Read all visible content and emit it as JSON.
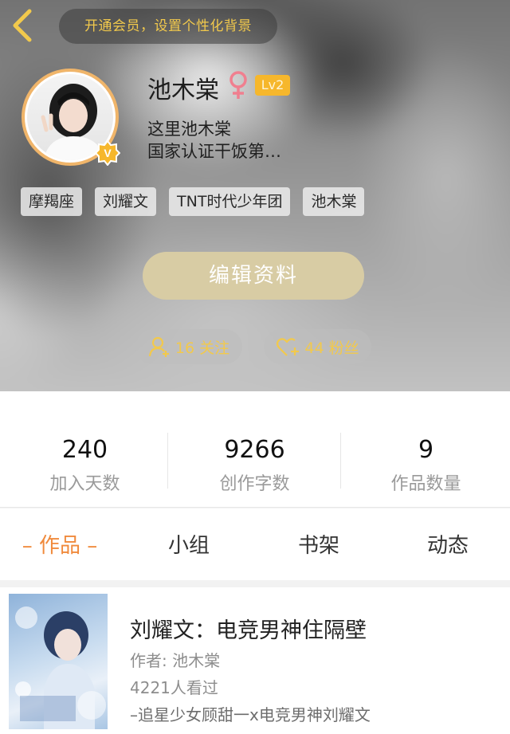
{
  "header": {
    "vip_prompt": "开通会员，设置个性化背景"
  },
  "profile": {
    "name": "池木棠",
    "level": "Lv2",
    "bio_lines": [
      "这里池木棠",
      "国家认证干饭第…"
    ],
    "tags": [
      "摩羯座",
      "刘耀文",
      "TNT时代少年团",
      "池木棠"
    ],
    "edit_label": "编辑资料",
    "following": "16 关注",
    "fans": "44 粉丝"
  },
  "stats": [
    {
      "value": "240",
      "label": "加入天数"
    },
    {
      "value": "9266",
      "label": "创作字数"
    },
    {
      "value": "9",
      "label": "作品数量"
    }
  ],
  "tabs": [
    "– 作品 –",
    "小组",
    "书架",
    "动态"
  ],
  "books": [
    {
      "title": "刘耀文：电竞男神住隔壁",
      "author": "作者: 池木棠",
      "views": "4221人看过",
      "summary": "–追星少女顾甜一x电竞男神刘耀文"
    }
  ],
  "colors": {
    "accent": "#f08a3c",
    "gold": "#f2c94c",
    "level_badge": "#f6b72c",
    "edit_button": "#d8cca4"
  },
  "icons": {
    "back": "chevron-left-icon",
    "gender": "female-symbol-icon",
    "verified": "v-badge-icon",
    "following": "user-plus-icon",
    "fans": "heart-plus-icon"
  }
}
